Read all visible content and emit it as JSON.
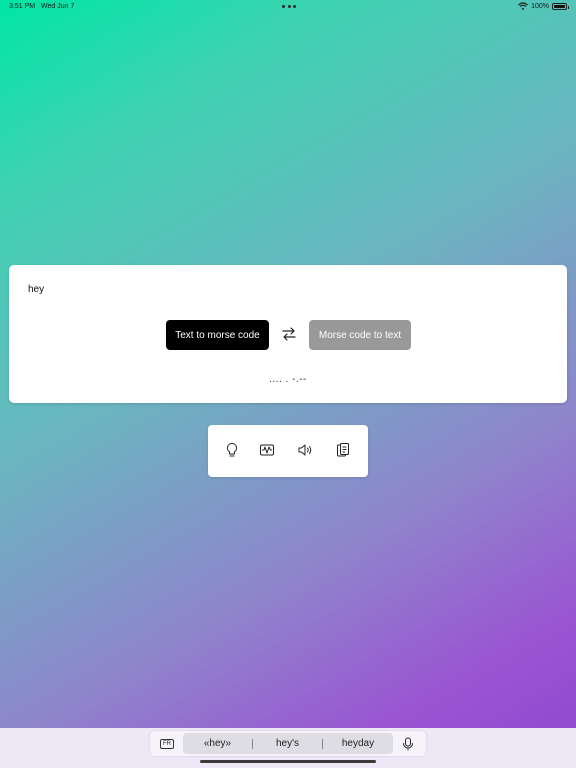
{
  "status_bar": {
    "time": "3:51 PM",
    "date": "Wed Jun 7",
    "battery": "100%",
    "battery_level": 1.0,
    "icons": [
      "wifi-icon",
      "battery-icon"
    ]
  },
  "translator": {
    "input_text": "hey",
    "mode_buttons": {
      "text_to_morse": "Text to morse code",
      "morse_to_text": "Morse code to text"
    },
    "active_mode": "text_to_morse",
    "output": ".... . -.--"
  },
  "toolbar": {
    "tools": [
      "lightbulb-icon",
      "waveform-icon",
      "speaker-icon",
      "clipboard-icon"
    ]
  },
  "keyboard": {
    "language": "FR",
    "suggestions": [
      "«hey»",
      "hey's",
      "heyday"
    ]
  },
  "colors": {
    "active_button": "#000000",
    "inactive_button": "#999999",
    "gradient": [
      "#00e6a6",
      "#8e46cf"
    ]
  }
}
